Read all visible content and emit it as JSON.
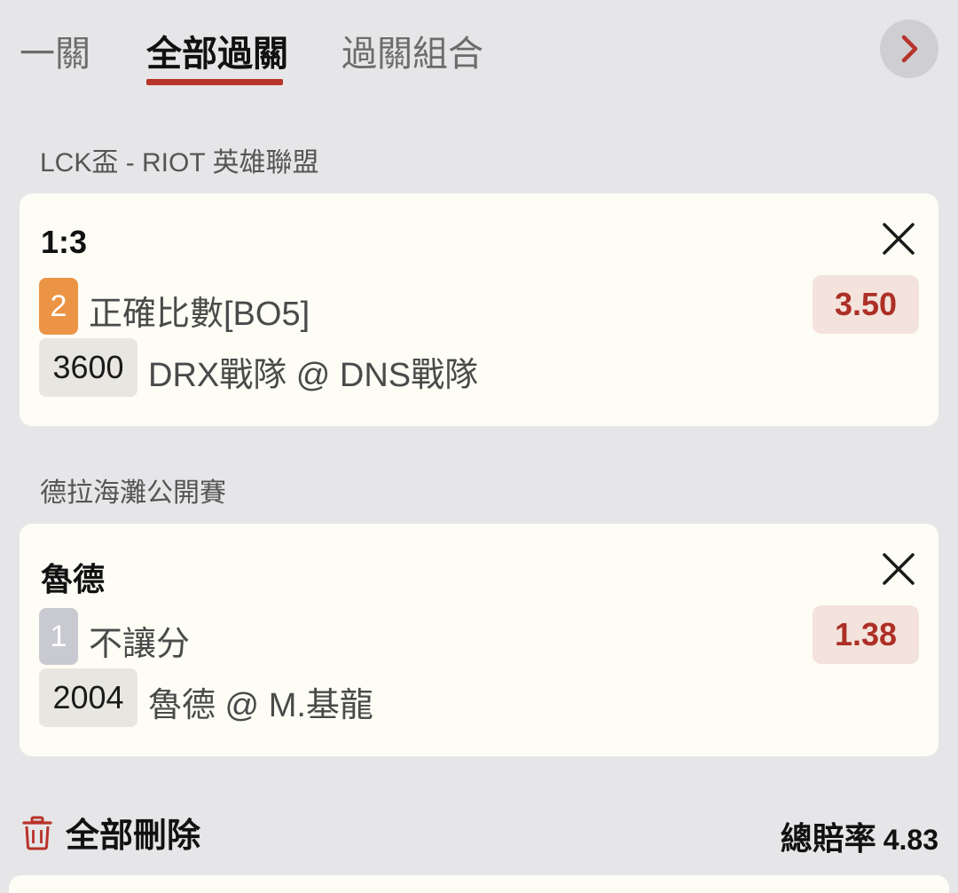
{
  "tabs": [
    {
      "label": "一關"
    },
    {
      "label": "全部過關"
    },
    {
      "label": "過關組合"
    }
  ],
  "active_tab": "全部過關",
  "accent_color": "#b8332a",
  "bets": [
    {
      "league": "LCK盃 - RIOT 英雄聯盟",
      "selection": "1:3",
      "leg_number": "2",
      "leg_color": "#ec9445",
      "market": "正確比數[BO5]",
      "odds": "3.50",
      "match_code": "3600",
      "match": "DRX戰隊 @ DNS戰隊"
    },
    {
      "league": "德拉海灘公開賽",
      "selection": "魯德",
      "leg_number": "1",
      "leg_color": "#c9c9d1",
      "market": "不讓分",
      "odds": "1.38",
      "match_code": "2004",
      "match": "魯德 @ M.基龍"
    }
  ],
  "footer": {
    "delete_all_label": "全部刪除",
    "total_odds_label": "總賠率",
    "total_odds_value": "4.83"
  }
}
